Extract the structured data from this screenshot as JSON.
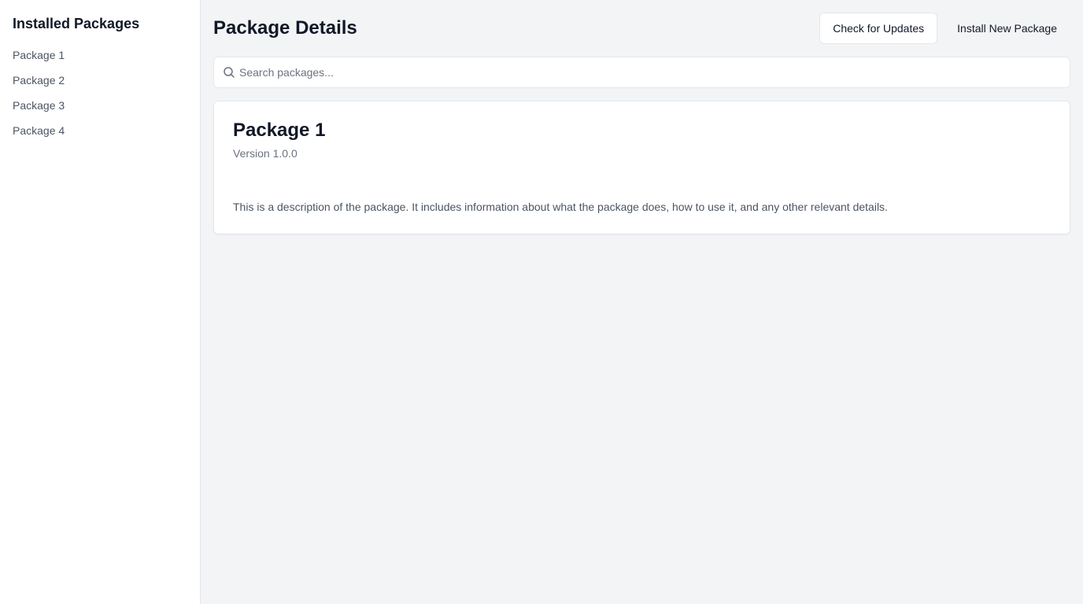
{
  "sidebar": {
    "title": "Installed Packages",
    "items": [
      {
        "label": "Package 1"
      },
      {
        "label": "Package 2"
      },
      {
        "label": "Package 3"
      },
      {
        "label": "Package 4"
      }
    ]
  },
  "header": {
    "title": "Package Details",
    "check_updates_label": "Check for Updates",
    "install_label": "Install New Package"
  },
  "search": {
    "placeholder": "Search packages...",
    "value": "",
    "icon": "search-icon"
  },
  "package": {
    "name": "Package 1",
    "version": "Version 1.0.0",
    "description": "This is a description of the package. It includes information about what the package does, how to use it, and any other relevant details."
  },
  "colors": {
    "background": "#f3f4f6",
    "surface": "#ffffff",
    "border": "#e5e7eb",
    "text_primary": "#111827",
    "text_secondary": "#6b7280"
  }
}
